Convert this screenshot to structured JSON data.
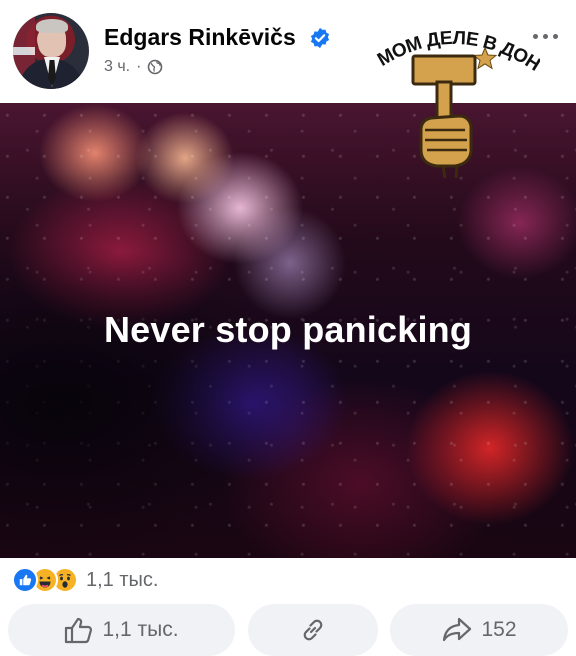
{
  "post": {
    "author_name": "Edgars Rinkēvičs",
    "timestamp": "3 ч.",
    "separator": "·",
    "audience_icon": "globe-icon",
    "verified_icon": "verified-badge-icon",
    "menu_icon": "more-options-icon"
  },
  "image": {
    "text": "Never stop panicking",
    "sticker_text": "НА САМОМ ДЕЛЕ В ДОНЕЦКЕ",
    "sticker_icon": "fist-hammer-star-icon"
  },
  "reactions": {
    "icons": [
      "like-reaction-icon",
      "haha-reaction-icon",
      "wow-reaction-icon"
    ],
    "count": "1,1 тыс."
  },
  "actions": {
    "like_count": "1,1 тыс.",
    "share_count": "152"
  },
  "colors": {
    "accent": "#1877f2",
    "secondary_text": "#65676b",
    "button_bg": "#f0f2f5",
    "reaction_yellow": "#f7b125"
  }
}
